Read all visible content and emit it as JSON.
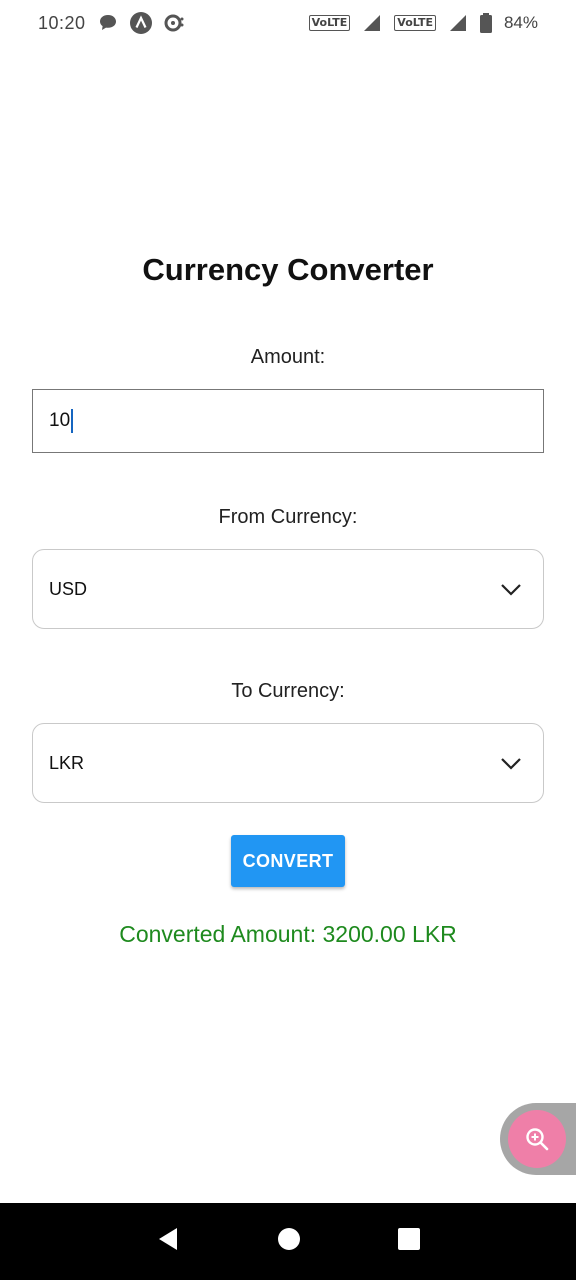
{
  "status_bar": {
    "time": "10:20",
    "lte1": "VoLTE",
    "lte2": "VoLTE",
    "battery": "84%"
  },
  "app": {
    "title": "Currency Converter",
    "amount_label": "Amount:",
    "amount_value": "10",
    "from_label": "From Currency:",
    "from_value": "USD",
    "to_label": "To Currency:",
    "to_value": "LKR",
    "convert_label": "CONVERT",
    "result_text": "Converted Amount: 3200.00 LKR"
  },
  "colors": {
    "accent": "#2196f3",
    "result": "#1e8a1e",
    "fab": "#ef7fa8"
  },
  "icons": [
    "chat-icon",
    "app-a-icon",
    "sync-icon",
    "signal-icon",
    "battery-icon",
    "chevron-down-icon",
    "zoom-in-icon",
    "back-icon",
    "home-icon",
    "recents-icon"
  ]
}
